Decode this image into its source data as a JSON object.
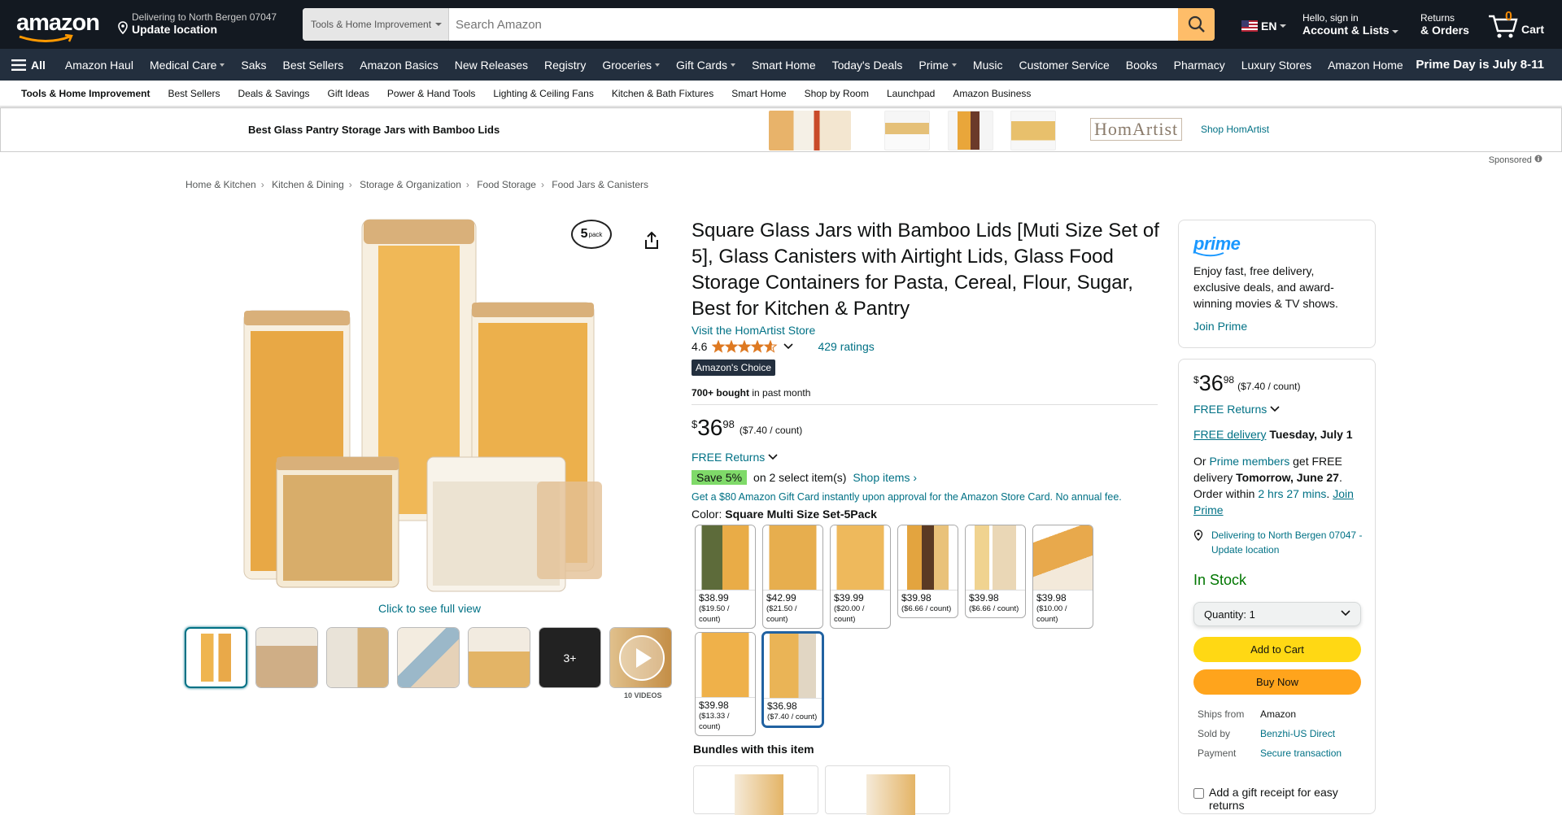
{
  "header": {
    "logo_text": "amazon",
    "deliver_line1": "Delivering to North Bergen 07047",
    "deliver_line2": "Update location",
    "search_category": "Tools & Home Improvement",
    "search_placeholder": "Search Amazon",
    "language": "EN",
    "account_line1": "Hello, sign in",
    "account_line2": "Account & Lists",
    "returns_line1": "Returns",
    "returns_line2": "& Orders",
    "cart_count": "0",
    "cart_label": "Cart"
  },
  "nav": {
    "all_label": "All",
    "items": [
      "Amazon Haul",
      "Medical Care",
      "Saks",
      "Best Sellers",
      "Amazon Basics",
      "New Releases",
      "Registry",
      "Groceries",
      "Gift Cards",
      "Smart Home",
      "Today's Deals",
      "Prime",
      "Music",
      "Customer Service",
      "Books",
      "Pharmacy",
      "Luxury Stores",
      "Amazon Home"
    ],
    "promo": "Prime Day is July 8-11"
  },
  "subnav": {
    "items": [
      "Tools & Home Improvement",
      "Best Sellers",
      "Deals & Savings",
      "Gift Ideas",
      "Power & Hand Tools",
      "Lighting & Ceiling Fans",
      "Kitchen & Bath Fixtures",
      "Smart Home",
      "Shop by Room",
      "Launchpad",
      "Amazon Business"
    ]
  },
  "banner": {
    "title": "Best Glass Pantry Storage Jars with Bamboo Lids",
    "brand_logo": "HomArtist",
    "shop_link": "Shop HomArtist",
    "sponsored": "Sponsored"
  },
  "breadcrumb": [
    "Home & Kitchen",
    "Kitchen & Dining",
    "Storage & Organization",
    "Food Storage",
    "Food Jars & Canisters"
  ],
  "gallery": {
    "pack_badge_num": "5",
    "pack_badge_word": "pack",
    "full_view": "Click to see full view",
    "more_label": "3+",
    "videos_label": "10 VIDEOS"
  },
  "product": {
    "title": "Square Glass Jars with Bamboo Lids [Muti Size Set of 5], Glass Canisters with Airtight Lids, Glass Food Storage Containers for Pasta, Cereal, Flour, Sugar, Best for Kitchen & Pantry",
    "store": "Visit the HomArtist Store",
    "rating": "4.6",
    "rating_value": 4.6,
    "ratings_count": "429 ratings",
    "choice_badge": "Amazon's Choice",
    "bought_bold": "700+ bought",
    "bought_rest": " in past month",
    "price_symbol": "$",
    "price_whole": "36",
    "price_fraction": "98",
    "price_unit": "($7.40 / count)",
    "free_returns": "FREE Returns",
    "save_badge": "Save 5%",
    "save_text": "on 2 select item(s)",
    "shop_items": "Shop items",
    "gift_card": "Get a $80 Amazon Gift Card instantly upon approval for the Amazon Store Card. No annual fee.",
    "color_label": "Color: ",
    "color_value": "Square Multi Size Set-5Pack",
    "swatches": [
      {
        "price": "$38.99",
        "unit": "($19.50 / count)"
      },
      {
        "price": "$42.99",
        "unit": "($21.50 / count)"
      },
      {
        "price": "$39.99",
        "unit": "($20.00 / count)"
      },
      {
        "price": "$39.98",
        "unit": "($6.66 / count)"
      },
      {
        "price": "$39.98",
        "unit": "($6.66 / count)"
      },
      {
        "price": "$39.98",
        "unit": "($10.00 / count)"
      },
      {
        "price": "$39.98",
        "unit": "($13.33 / count)"
      },
      {
        "price": "$36.98",
        "unit": "($7.40 / count)"
      }
    ],
    "bundles_title": "Bundles with this item"
  },
  "buybox": {
    "prime_logo": "prime",
    "prime_text": "Enjoy fast, free delivery, exclusive deals, and award-winning movies & TV shows.",
    "join_prime": "Join Prime",
    "price_symbol": "$",
    "price_whole": "36",
    "price_fraction": "98",
    "price_unit": "($7.40 / count)",
    "free_returns": "FREE Returns",
    "free_delivery": "FREE delivery",
    "delivery_date": "Tuesday, July 1",
    "or_text": "Or ",
    "prime_members": "Prime members",
    "get_free": " get FREE delivery ",
    "fast_date": "Tomorrow, June 27",
    "order_within": ". Order within ",
    "countdown": "2 hrs 27 mins",
    "join_prime2": "Join Prime",
    "location": "Delivering to North Bergen 07047 - Update location",
    "stock": "In Stock",
    "quantity_label": "Quantity:",
    "quantity_value": "1",
    "add_to_cart": "Add to Cart",
    "buy_now": "Buy Now",
    "ships_from_k": "Ships from",
    "ships_from_v": "Amazon",
    "sold_by_k": "Sold by",
    "sold_by_v": "Benzhi-US Direct",
    "payment_k": "Payment",
    "payment_v": "Secure transaction",
    "gift_receipt": "Add a gift receipt for easy returns"
  },
  "colors": {
    "header_bg": "#131921",
    "nav_bg": "#232f3e",
    "search_btn": "#febd69",
    "link": "#007185",
    "add_to_cart": "#ffd814",
    "buy_now": "#ffa41c",
    "in_stock": "#007600",
    "star": "#de7921"
  }
}
